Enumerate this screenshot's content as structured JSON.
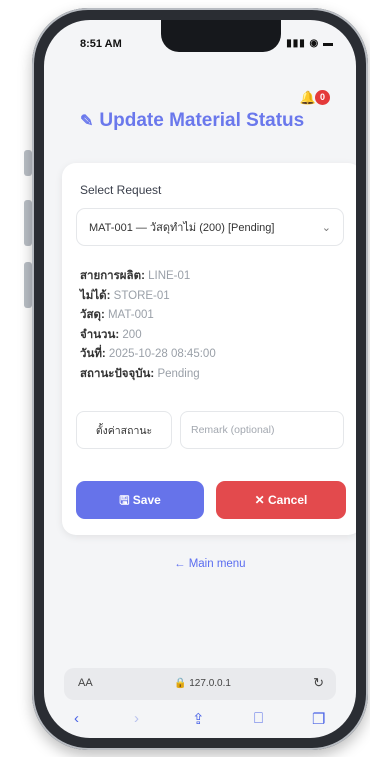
{
  "status_bar": {
    "time": "8:51 AM",
    "icons": "▮▮▮ ◉ ▬"
  },
  "header": {
    "bell": "🔔",
    "badge_count": "0",
    "title": "Update Material Status",
    "title_icon": "✎"
  },
  "card": {
    "label": "Select Request",
    "select_value": "MAT-001 — วัสดุทำไม่ (200) [Pending]",
    "chevron": "⌄",
    "info": [
      {
        "key": "สายการผลิต:",
        "value": " LINE-01"
      },
      {
        "key": "ไม่ได้:",
        "value": " STORE-01"
      },
      {
        "key": "วัสดุ:",
        "value": " MAT-001"
      },
      {
        "key": "จำนวน:",
        "value": " 200"
      },
      {
        "key": "วันที่:",
        "value": " 2025-10-28 08:45:00"
      },
      {
        "key": "สถานะปัจจุบัน:",
        "value": " Pending"
      }
    ],
    "status_select": "ตั้งค่าสถานะ",
    "remark_placeholder": "Remark (optional)",
    "save": "🖫 Save",
    "cancel": "✕ Cancel"
  },
  "main_menu": "←  Main menu",
  "browser": {
    "aa": "AA",
    "url": "🔒 127.0.0.1",
    "reload": "↻",
    "tabs": [
      "‹",
      "›",
      "⇪",
      "⎕",
      "❐"
    ]
  },
  "colors": {
    "accent": "#6673ea",
    "danger": "#e34a4d",
    "badge": "#e43a3a"
  }
}
